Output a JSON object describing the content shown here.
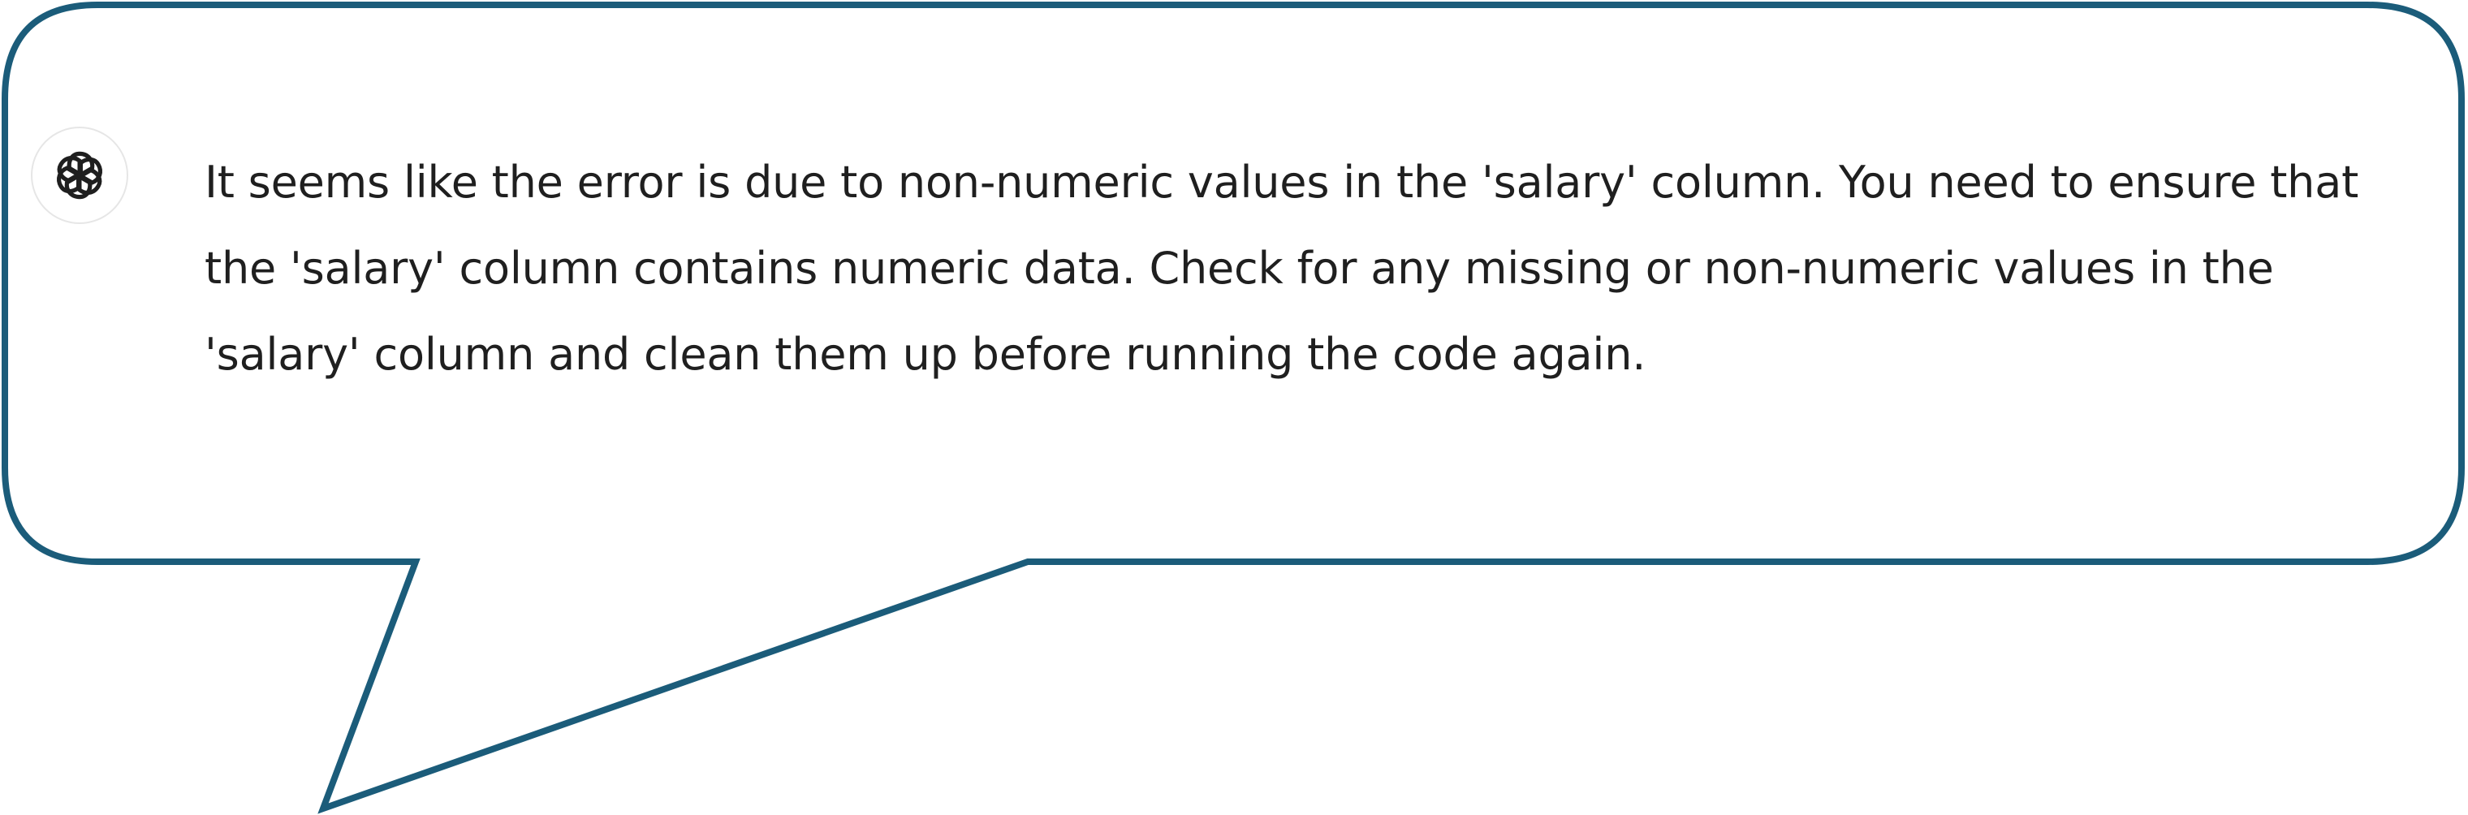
{
  "chat": {
    "assistant_avatar": {
      "icon": "openai-logo-icon"
    },
    "message": {
      "lines": [
        "It seems like the error is due to non-numeric values in the 'salary' column. You need to ensure that",
        "the 'salary' column contains numeric data. Check for any missing or non-numeric values in the",
        "'salary' column and clean them up before running the code again."
      ]
    }
  },
  "theme": {
    "bubble_border": "#1b5c7a",
    "text": "#1f1f1f",
    "avatar_border": "#e6e6e6"
  }
}
